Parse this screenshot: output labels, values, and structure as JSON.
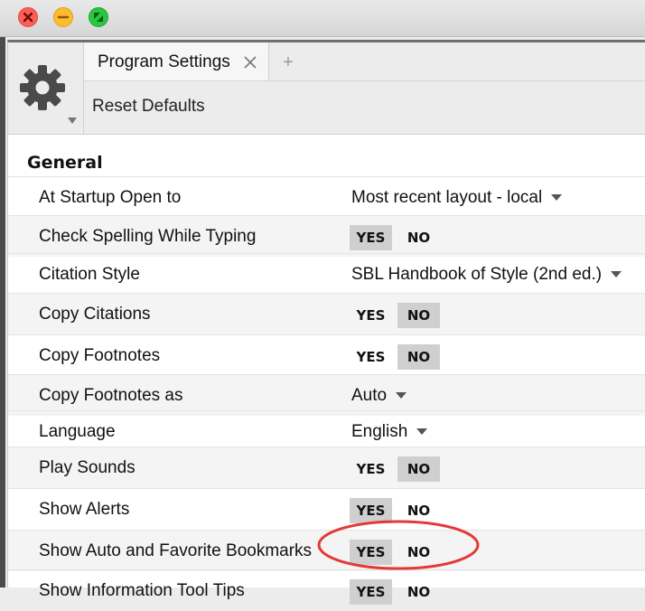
{
  "window": {
    "tab_title": "Program Settings",
    "new_tab_symbol": "+",
    "reset_label": "Reset Defaults"
  },
  "section": {
    "title": "General"
  },
  "yes_label": "YES",
  "no_label": "NO",
  "settings": [
    {
      "label": "At Startup Open to",
      "type": "dropdown",
      "value": "Most recent layout - local"
    },
    {
      "label": "Check Spelling While Typing",
      "type": "toggle",
      "value": "YES"
    },
    {
      "label": "Citation Style",
      "type": "dropdown",
      "value": "SBL Handbook of Style (2nd ed.)"
    },
    {
      "label": "Copy Citations",
      "type": "toggle",
      "value": "NO"
    },
    {
      "label": "Copy Footnotes",
      "type": "toggle",
      "value": "NO"
    },
    {
      "label": "Copy Footnotes as",
      "type": "dropdown",
      "value": "Auto"
    },
    {
      "label": "Language",
      "type": "dropdown",
      "value": "English"
    },
    {
      "label": "Play Sounds",
      "type": "toggle",
      "value": "NO"
    },
    {
      "label": "Show Alerts",
      "type": "toggle",
      "value": "YES"
    },
    {
      "label": "Show Auto and Favorite Bookmarks",
      "type": "toggle",
      "value": "YES"
    },
    {
      "label": "Show Information Tool Tips",
      "type": "toggle",
      "value": "YES"
    }
  ],
  "colors": {
    "close": "#fc5f57",
    "minimize": "#fdbc2e",
    "maximize": "#28c840",
    "toggle_selected": "#cfcfcf",
    "annotation": "#e53935"
  }
}
